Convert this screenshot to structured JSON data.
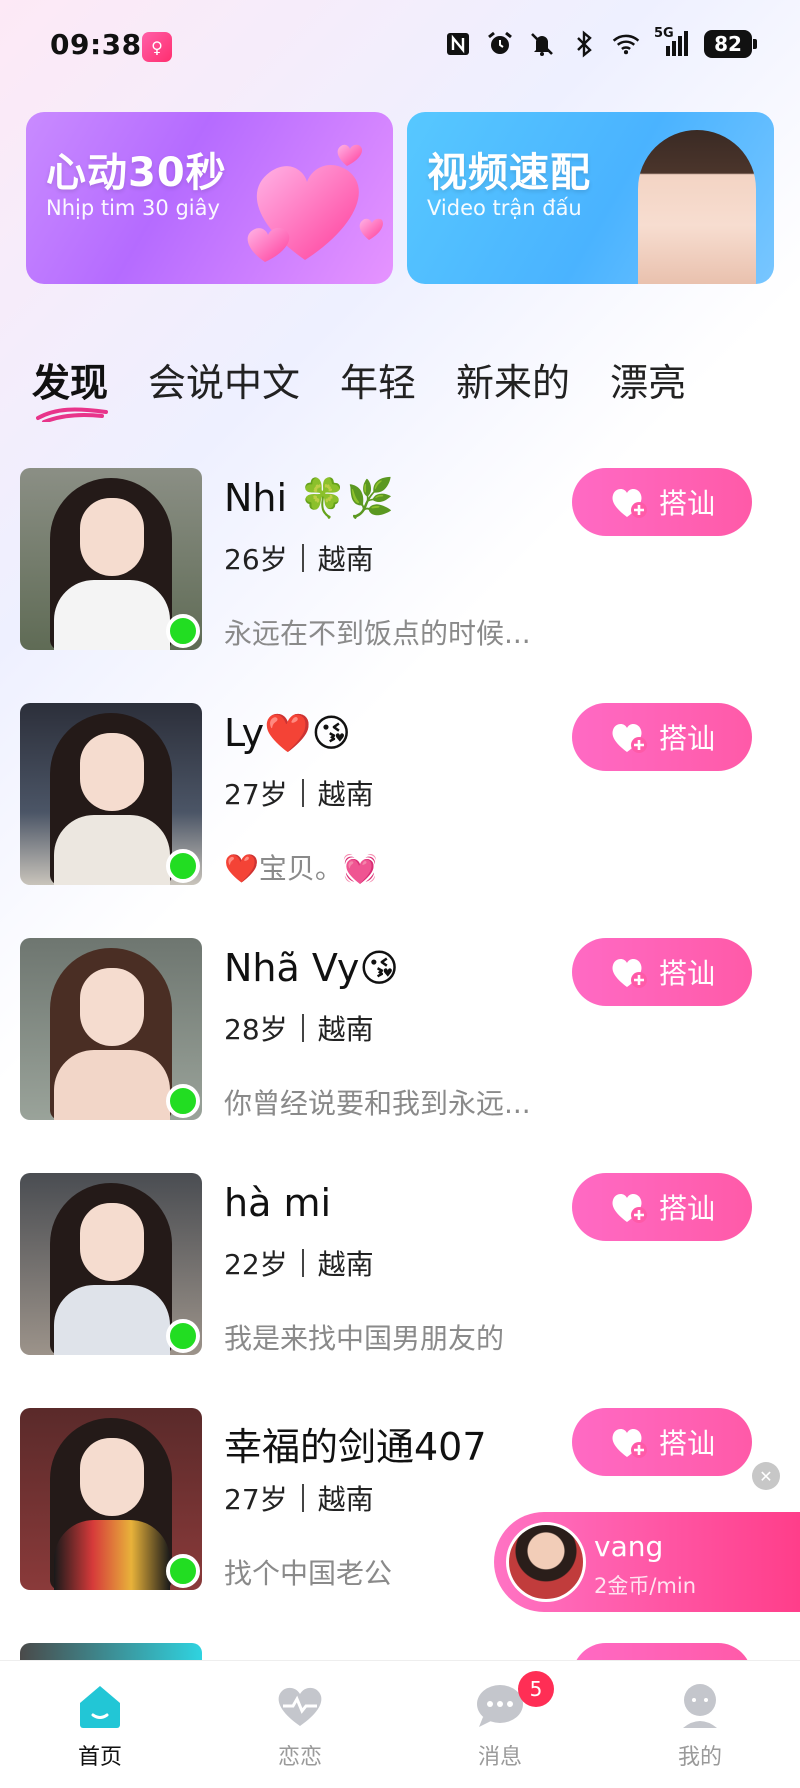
{
  "status_bar": {
    "time": "09:38",
    "network": "5G",
    "battery": "82",
    "icons": [
      "nfc-icon",
      "alarm-icon",
      "mute-icon",
      "bluetooth-icon",
      "wifi-icon",
      "signal-icon"
    ]
  },
  "banners": [
    {
      "title": "心动30秒",
      "subtitle": "Nhịp tim 30 giây"
    },
    {
      "title": "视频速配",
      "subtitle": "Video trận đấu"
    }
  ],
  "tabs": [
    {
      "label": "发现",
      "active": true
    },
    {
      "label": "会说中文"
    },
    {
      "label": "年轻"
    },
    {
      "label": "新来的"
    },
    {
      "label": "漂亮"
    }
  ],
  "greet_label": "搭讪",
  "users": [
    {
      "name": "Nhi 🍀🌿",
      "age": "26岁",
      "country": "越南",
      "bio": "永远在不到饭点的时候..."
    },
    {
      "name": "Ly❤️😘",
      "age": "27岁",
      "country": "越南",
      "bio": "❤️宝贝。💓"
    },
    {
      "name": "Nhã Vy😘",
      "age": "28岁",
      "country": "越南",
      "bio": "你曾经说要和我到永远..."
    },
    {
      "name": "hà mi",
      "age": "22岁",
      "country": "越南",
      "bio": "我是来找中国男朋友的"
    },
    {
      "name": "幸福的剑通407",
      "age": "27岁",
      "country": "越南",
      "bio": "找个中国老公"
    }
  ],
  "call_card": {
    "name": "vang",
    "rate": "2金币/min"
  },
  "nav": [
    {
      "label": "首页",
      "icon": "home-icon",
      "active": true
    },
    {
      "label": "恋恋",
      "icon": "heartbeat-icon"
    },
    {
      "label": "消息",
      "icon": "chat-icon",
      "badge": "5"
    },
    {
      "label": "我的",
      "icon": "profile-icon"
    }
  ],
  "colors": {
    "accent_pink": "#ff5aa8",
    "online_green": "#22dd22",
    "nav_active": "#22c6d6"
  }
}
